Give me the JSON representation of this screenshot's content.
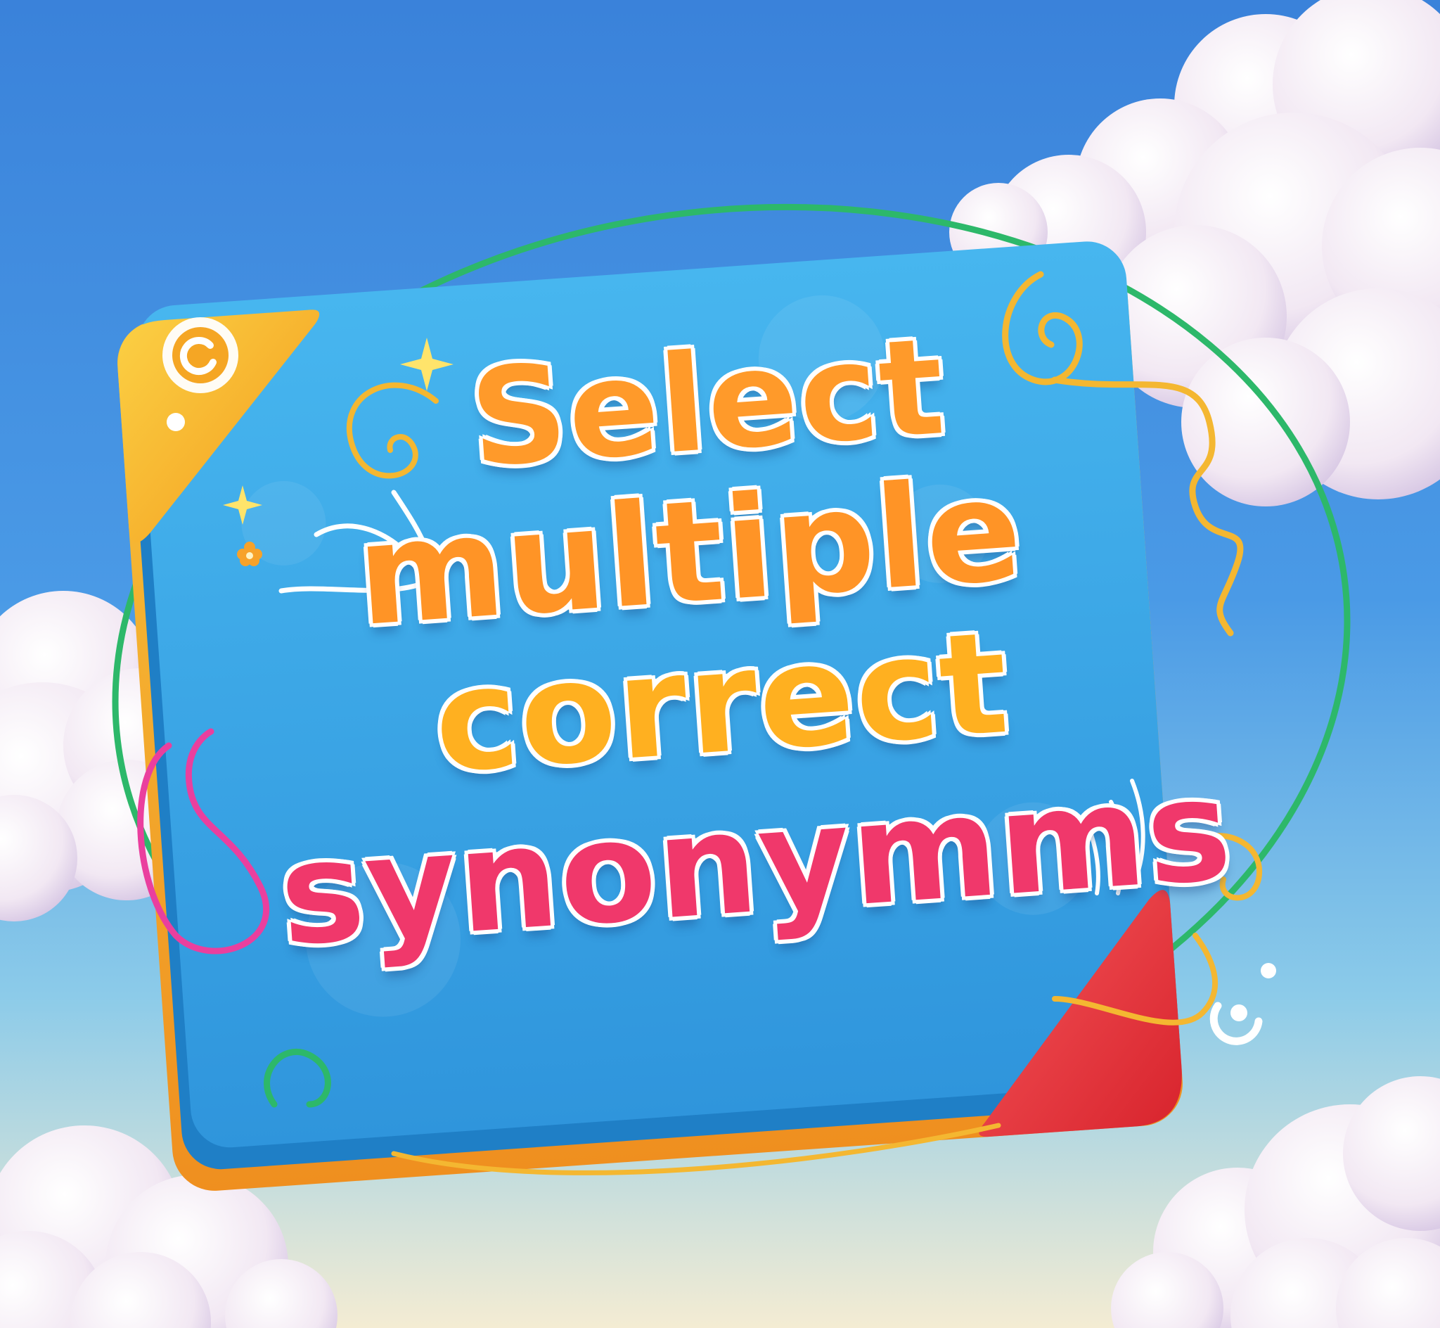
{
  "title": {
    "line1": "Select",
    "line2": "multiple",
    "line3": "correct",
    "line4": "synonymms"
  },
  "colors": {
    "sky_top": "#3a86dc",
    "sky_bottom": "#f3ead2",
    "board_blue": "#3fa9e8",
    "board_frame": "#f2a226",
    "corner_yellow": "#f7b52a",
    "corner_red": "#e8333a",
    "title_orange": "#ff9426",
    "title_yellow": "#ffb020",
    "title_pink": "#f0386b",
    "ring_green": "#2db86a",
    "ring_pink": "#ea3f9e",
    "swirl_gold": "#f4b731"
  },
  "icons": {
    "top_left_corner": "swirl-emblem-icon",
    "bottom_right_corner": "swirl-emblem-icon",
    "sparkles": "sparkle-icon",
    "flower": "flower-icon"
  }
}
